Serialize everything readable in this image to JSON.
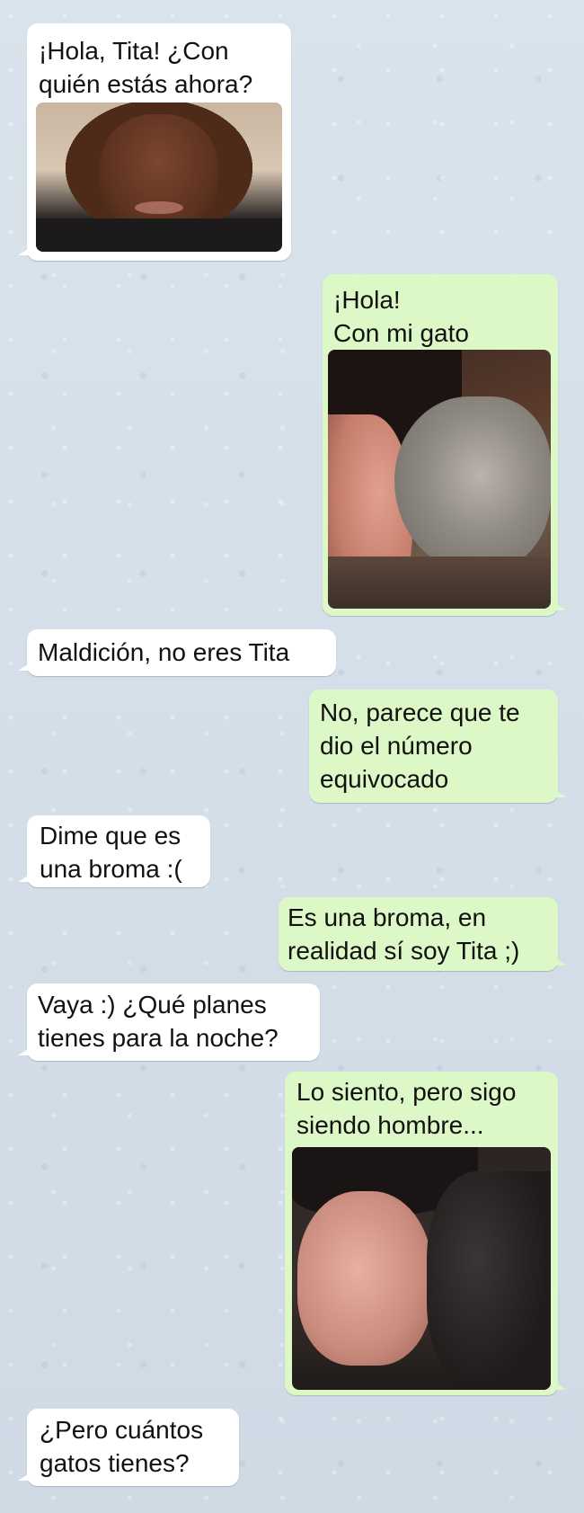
{
  "messages": [
    {
      "direction": "incoming",
      "text": "¡Hola, Tita! ¿Con\nquién estás ahora?",
      "photo": "selfie of a man"
    },
    {
      "direction": "outgoing",
      "text": "¡Hola!\nCon mi gato",
      "photo": "selfie with a gray tabby cat"
    },
    {
      "direction": "incoming",
      "text": "Maldición, no eres Tita"
    },
    {
      "direction": "outgoing",
      "text": "No, parece que te\ndio el número\nequivocado"
    },
    {
      "direction": "incoming",
      "text": "Dime que es\nuna broma :("
    },
    {
      "direction": "outgoing",
      "text": "Es una broma, en\nrealidad sí soy Tita ;)"
    },
    {
      "direction": "incoming",
      "text": "Vaya :) ¿Qué planes\ntienes para la noche?"
    },
    {
      "direction": "outgoing",
      "text": "Lo siento, pero sigo\nsiendo hombre...",
      "photo": "selfie with a black cat"
    },
    {
      "direction": "incoming",
      "text": "¿Pero cuántos\ngatos tienes?"
    }
  ],
  "colors": {
    "incoming_bubble": "#ffffff",
    "outgoing_bubble": "#dcf8c6",
    "background": "#d6e0ea"
  }
}
